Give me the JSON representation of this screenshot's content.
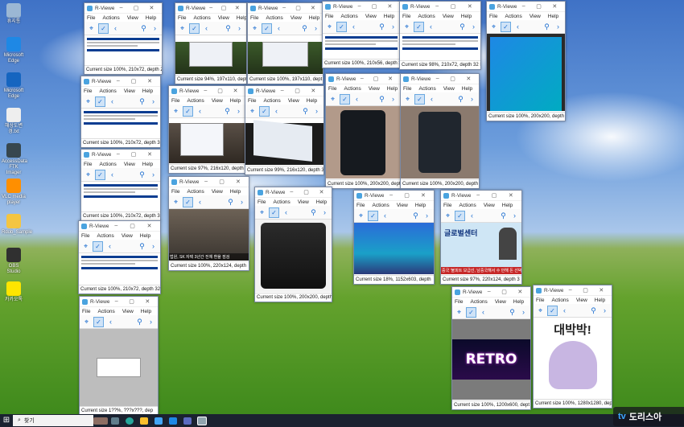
{
  "desktop_icons": [
    {
      "label": "휴지통",
      "color": "#9bb7d4",
      "icon": "recycle-bin-icon"
    },
    {
      "label": "Microsoft Edge",
      "color": "#1e88e5",
      "icon": "edge-icon"
    },
    {
      "label": "Microsoft Edge",
      "color": "#1565c0",
      "icon": "edge-icon"
    },
    {
      "label": "해상도변경.txt",
      "color": "#eeeeee",
      "icon": "text-file-icon"
    },
    {
      "label": "AccessData FTK Imager",
      "color": "#37474f",
      "icon": "ftk-imager-icon"
    },
    {
      "label": "VLC media player",
      "color": "#ff8f00",
      "icon": "vlc-icon"
    },
    {
      "label": "Rdob_Sample",
      "color": "#f4c542",
      "icon": "folder-icon"
    },
    {
      "label": "OBS Studio",
      "color": "#303030",
      "icon": "obs-icon"
    },
    {
      "label": "카카오톡",
      "color": "#fee500",
      "icon": "kakaotalk-icon"
    }
  ],
  "viewer": {
    "title": "R-Viewe...",
    "menu": [
      "File",
      "Actions",
      "View",
      "Help"
    ]
  },
  "windows": [
    {
      "status": "Current size 100%, 210x72, depth 2"
    },
    {
      "status": "Current size 94%, 197x110, depth"
    },
    {
      "status": "Current size 100%, 197x110, dept"
    },
    {
      "status": "Current size 100%, 210x56, depth 32"
    },
    {
      "status": "Current size 98%, 210x72, depth 32 E"
    },
    {
      "status": "Current size 100%, 200x200, depth"
    },
    {
      "status": "Current size 100%, 210x72, depth 3"
    },
    {
      "status": "Current size 97%, 216x120, depth 3"
    },
    {
      "status": "Current size 99%, 216x120, depth 3"
    },
    {
      "status": "Current size 100%, 200x200, dept"
    },
    {
      "status": "Current size 100%, 200x200, depth"
    },
    {
      "status": "Current size 100%, 210x72, depth 3"
    },
    {
      "status": "Current size 100%, 220x124, depth"
    },
    {
      "status": "Current size 100%, 200x200, depth"
    },
    {
      "status": "Current size 18%, 1152x603, depth"
    },
    {
      "status": "Current size 97%, 220x124, depth 3"
    },
    {
      "status": "Current size 100%, 210x72, depth 32"
    },
    {
      "status": "Current size 100%, 1200x600, dept"
    },
    {
      "status": "Current size 100%, 1280x1280, dep"
    },
    {
      "status": "Current size 1??%, ???x???, dep"
    }
  ],
  "image_texts": {
    "news_caption": "법원, SK 자택 3년간 전체 환율 점검",
    "global_center": "글로벌센터",
    "global_caption": "중국 '불피트 보급선, 남중국해서 수 만해 돈 선박'",
    "retro": "RETRO",
    "meme": "대박박!"
  },
  "taskbar": {
    "search_placeholder": "찾기"
  },
  "watermark": {
    "text": "도리스아"
  }
}
